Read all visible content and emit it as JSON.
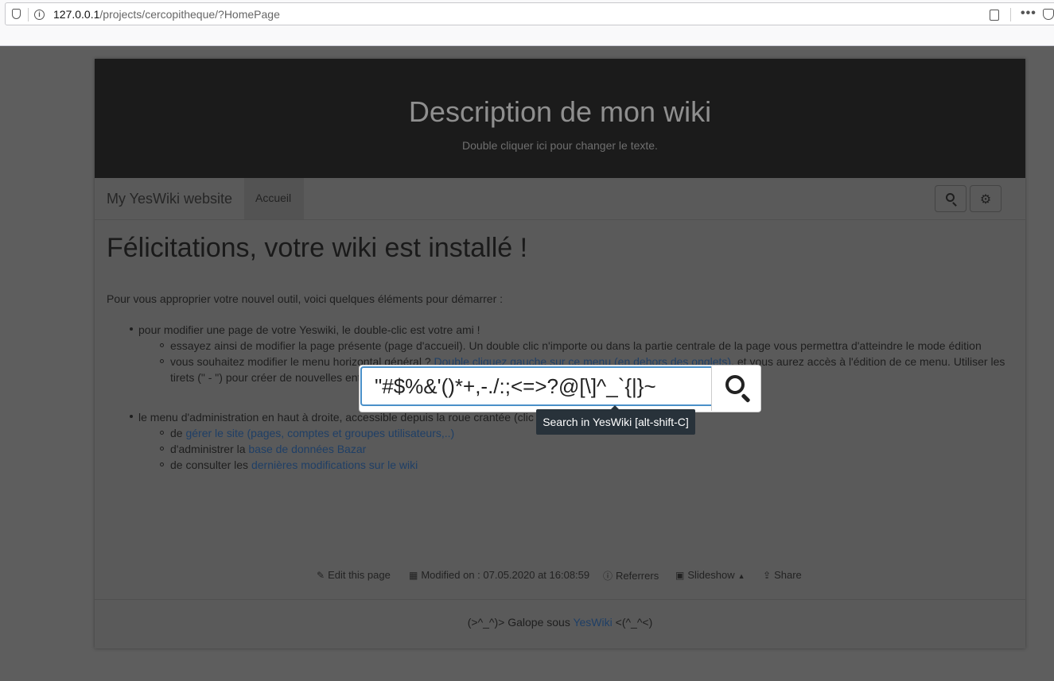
{
  "browser": {
    "url_host": "127.0.0.1",
    "url_path": "/projects/cercopitheque/?HomePage"
  },
  "header": {
    "title": "Description de mon wiki",
    "subtitle": "Double cliquer ici pour changer le texte."
  },
  "navbar": {
    "brand": "My YesWiki website",
    "tab_label": "Accueil"
  },
  "content": {
    "title": "Félicitations, votre wiki est installé !",
    "intro": "Pour vous approprier votre nouvel outil, voici quelques éléments pour démarrer :",
    "item1": "pour modifier une page de votre Yeswiki, le double-clic est votre ami !",
    "item1_sub1": "essayez ainsi de modifier la page présente (page d'accueil). Un double clic n'importe ou dans la partie centrale de la page vous permettra d'atteindre le mode édition",
    "item1_sub2_a": "vous souhaitez modifier le menu horizontal général ? ",
    "item1_sub2_link": "Double cliquez gauche sur ce menu (en dehors des onglets)",
    "item1_sub2_b": ", et vous aurez accès à l'édition de ce menu. Utiliser les",
    "item1_sub2_c": "tirets (\" - \") pour créer de nouvelles ent",
    "item2": "le menu d'administration en haut à droite, accessible depuis la roue crantée (clic",
    "item2_sub1_pre": "de ",
    "item2_sub1_link": "gérer le site (pages, comptes et groupes utilisateurs,..)",
    "item2_sub2_pre": "d'administrer la ",
    "item2_sub2_link": "base de données Bazar",
    "item2_sub3_pre": "de consulter les ",
    "item2_sub3_link": "dernières modifications sur le wiki"
  },
  "footer": {
    "edit": "Edit this page",
    "modified": "Modified on : 07.05.2020 at 16:08:59",
    "referrers": "Referrers",
    "slideshow": "Slideshow",
    "share": "Share",
    "credits_pre": "(>^_^)> Galope sous ",
    "credits_link": "YesWiki",
    "credits_post": " <(^_^<)"
  },
  "search": {
    "value": "\"#$%&'()*+,-./:;<=>?@[\\]^_`{|}~",
    "tooltip": "Search in YesWiki [alt-shift-C]"
  },
  "icons": [
    "shield-icon",
    "info-icon",
    "reader-icon",
    "more-icon",
    "pocket-icon",
    "search-icon",
    "gear-icon",
    "pencil-icon",
    "calendar-icon",
    "info-circle-icon",
    "slideshow-icon",
    "share-icon"
  ]
}
